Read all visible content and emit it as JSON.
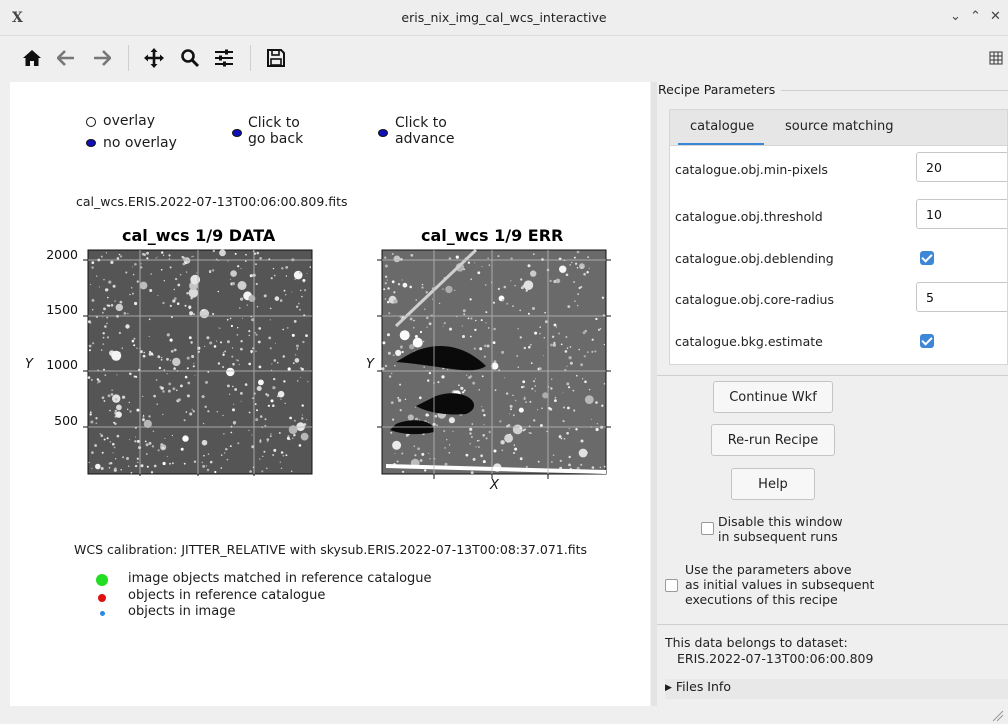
{
  "window": {
    "title": "eris_nix_img_cal_wcs_interactive",
    "app_icon": "x-icon",
    "controls": [
      "minimize-icon",
      "maximize-icon",
      "close-icon"
    ]
  },
  "toolbar": {
    "icons": [
      "home-icon",
      "back-arrow-icon",
      "forward-arrow-icon",
      "pan-icon",
      "zoom-icon",
      "configure-subplots-icon",
      "save-icon"
    ],
    "right_icon": "layout-icon"
  },
  "plot": {
    "legend_overlay": "overlay",
    "legend_no_overlay": "no overlay",
    "go_back_line1": "Click to",
    "go_back_line2": "go back",
    "advance_line1": "Click to",
    "advance_line2": "advance",
    "filename": "cal_wcs.ERIS.2022-07-13T00:06:00.809.fits",
    "wcs_caption": "WCS calibration: JITTER_RELATIVE with skysub.ERIS.2022-07-13T00:08:37.071.fits",
    "legend": [
      {
        "label": "image objects matched in reference catalogue",
        "color": "#22dd22"
      },
      {
        "label": "objects in reference catalogue",
        "color": "#e01010"
      },
      {
        "label": "objects in image",
        "color": "#2b8be0"
      }
    ],
    "marker_colors": {
      "overlay": "#ffffff",
      "no_overlay": "#1010b8"
    }
  },
  "chart_data": [
    {
      "type": "heatmap",
      "title": "cal_wcs 1/9 DATA",
      "xlabel": "",
      "ylabel": "Y",
      "yticks": [
        "2000",
        "1500",
        "1000",
        "500"
      ],
      "ylim": [
        0,
        2048
      ],
      "grid": true
    },
    {
      "type": "heatmap",
      "title": "cal_wcs 1/9 ERR",
      "xlabel": "X",
      "ylabel": "Y",
      "grid": true
    }
  ],
  "panel": {
    "group_title": "Recipe Parameters",
    "tabs": [
      {
        "label": "catalogue",
        "active": true
      },
      {
        "label": "source matching",
        "active": false
      }
    ],
    "params": [
      {
        "name": "catalogue.obj.min-pixels",
        "type": "int",
        "value": "20"
      },
      {
        "name": "catalogue.obj.threshold",
        "type": "int",
        "value": "10"
      },
      {
        "name": "catalogue.obj.deblending",
        "type": "bool",
        "value": true
      },
      {
        "name": "catalogue.obj.core-radius",
        "type": "int",
        "value": "5"
      },
      {
        "name": "catalogue.bkg.estimate",
        "type": "bool",
        "value": true
      }
    ],
    "continue_label": "Continue Wkf",
    "rerun_label": "Re-run Recipe",
    "help_label": "Help",
    "disable_line1": "Disable this window",
    "disable_line2": "in subsequent runs",
    "useparams_line1": "Use the parameters above",
    "useparams_line2": "as initial values in subsequent",
    "useparams_line3": "executions of this recipe",
    "dataset_label": "This data belongs to dataset:",
    "dataset_name": "ERIS.2022-07-13T00:06:00.809",
    "files_info": "Files Info",
    "accent_color": "#3d87d7"
  }
}
